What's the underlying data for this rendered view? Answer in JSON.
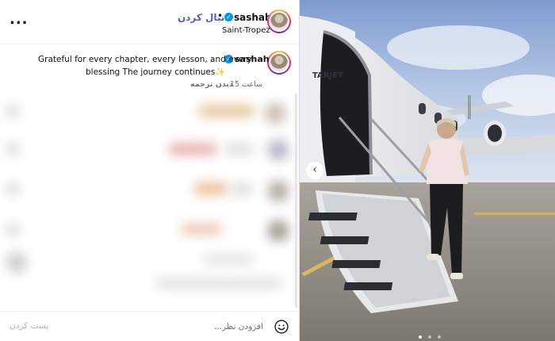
{
  "header": {
    "more_label": "...",
    "username": "sashah",
    "separator": "•",
    "follow_label": "دنبال کردن",
    "location": "Saint-Tropez"
  },
  "caption": {
    "username": "sashah",
    "line1": "Grateful for every chapter, every lesson, and every",
    "line2": "blessing The journey continues",
    "emoji": "✨",
    "time": "15 ساعت",
    "translate_label": "دیدن ترجمه"
  },
  "footer": {
    "comment_placeholder": "افزودن نظر...",
    "post_label": "پست کردن"
  },
  "media": {
    "prev_label": "‹",
    "plane_text": "TARJET",
    "carousel_count": 3,
    "carousel_active": 1
  },
  "colors": {
    "verified": "#0095f6",
    "follow": "#4f5bd5",
    "muted": "#737373"
  }
}
